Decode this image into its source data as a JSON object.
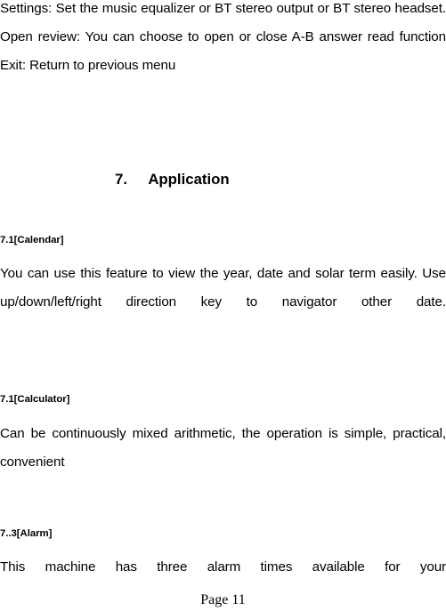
{
  "document": {
    "page_label": "Page 11"
  },
  "intro": {
    "lines": [
      "Settings: Set the music equalizer or BT stereo output or BT stereo headset.",
      "Open review: You can choose to open or close A-B answer read function",
      "Exit: Return to previous menu"
    ],
    "line_settings": "Settings: Set the music equalizer or BT stereo output or BT stereo headset.",
    "line_open_review": "Open review: You can choose to open or close A-B answer read function",
    "line_exit": "Exit: Return to previous menu"
  },
  "section": {
    "number": "7.",
    "title": "Application",
    "heading_full": "7.\tApplication"
  },
  "subsections": [
    {
      "heading": "7.1[Calendar]",
      "body": "You can use this feature to view the year, date and solar term easily. Use up/down/left/right direction key to navigator other date."
    },
    {
      "heading": "7.1[Calculator]",
      "body": "Can be continuously mixed arithmetic, the operation is simple, practical, convenient"
    },
    {
      "heading": "7..3[Alarm]",
      "body": "This machine has three alarm times available for your"
    }
  ]
}
